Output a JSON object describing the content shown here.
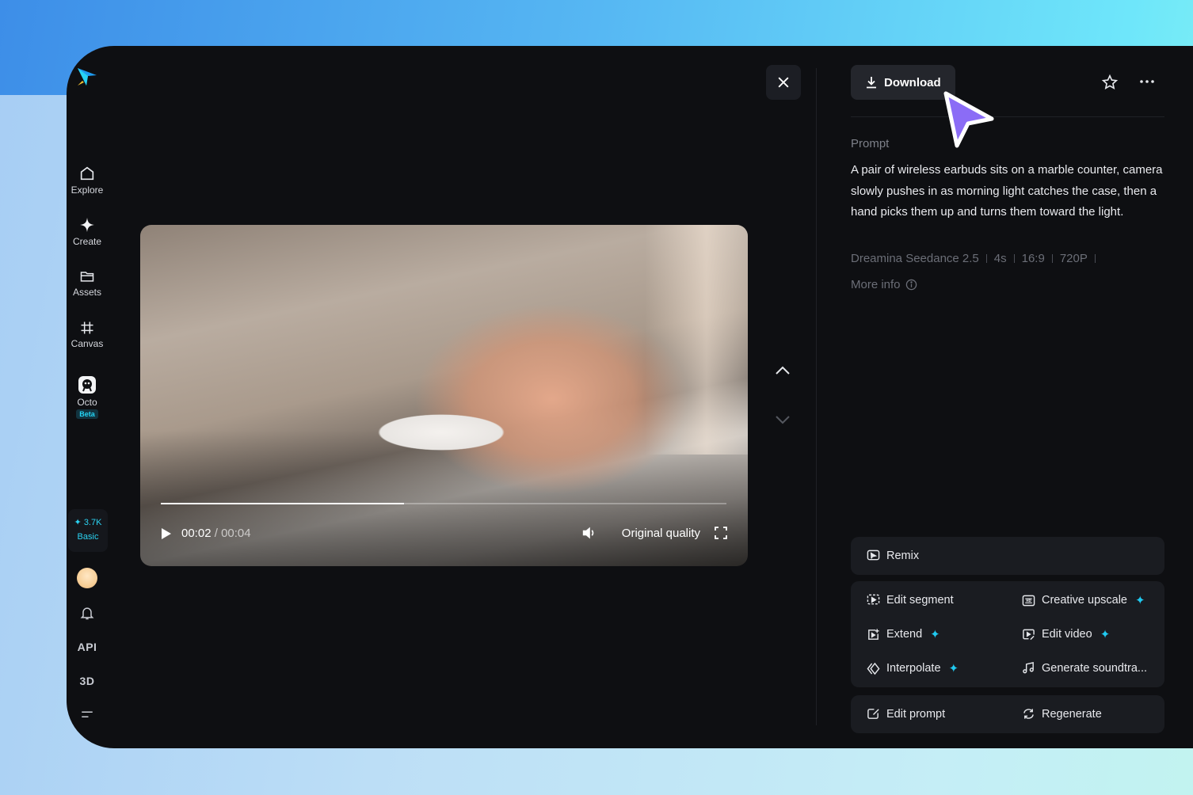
{
  "sidebar": {
    "items": [
      {
        "label": "Explore",
        "icon": "home-icon"
      },
      {
        "label": "Create",
        "icon": "sparkle-icon"
      },
      {
        "label": "Assets",
        "icon": "folder-icon"
      },
      {
        "label": "Canvas",
        "icon": "frame-icon"
      },
      {
        "label": "Octo",
        "icon": "octo-icon",
        "badge": "Beta"
      }
    ],
    "credits": {
      "count": "3.7K",
      "tier": "Basic"
    },
    "bottom": {
      "api": "API",
      "three_d": "3D"
    }
  },
  "player": {
    "current_time": "00:02",
    "total_time": "00:04",
    "separator": " / ",
    "progress": 0.43,
    "quality": "Original quality"
  },
  "panel": {
    "download_label": "Download",
    "prompt_label": "Prompt",
    "prompt_text": "A pair of wireless earbuds sits on a marble counter, camera slowly pushes in as morning light catches the case, then a hand picks them up and turns them toward the light.",
    "meta": {
      "model": "Dreamina Seedance 2.5",
      "duration": "4s",
      "ratio": "16:9",
      "resolution": "720P"
    },
    "more_info": "More info",
    "actions": {
      "remix": "Remix",
      "edit_segment": "Edit segment",
      "creative_upscale": "Creative upscale",
      "extend": "Extend",
      "edit_video": "Edit video",
      "interpolate": "Interpolate",
      "generate_soundtrack": "Generate soundtra...",
      "edit_prompt": "Edit prompt",
      "regenerate": "Regenerate"
    }
  },
  "colors": {
    "accent": "#20c9f0",
    "cursor": "#8b6cf6",
    "background": "#0e0f12"
  }
}
